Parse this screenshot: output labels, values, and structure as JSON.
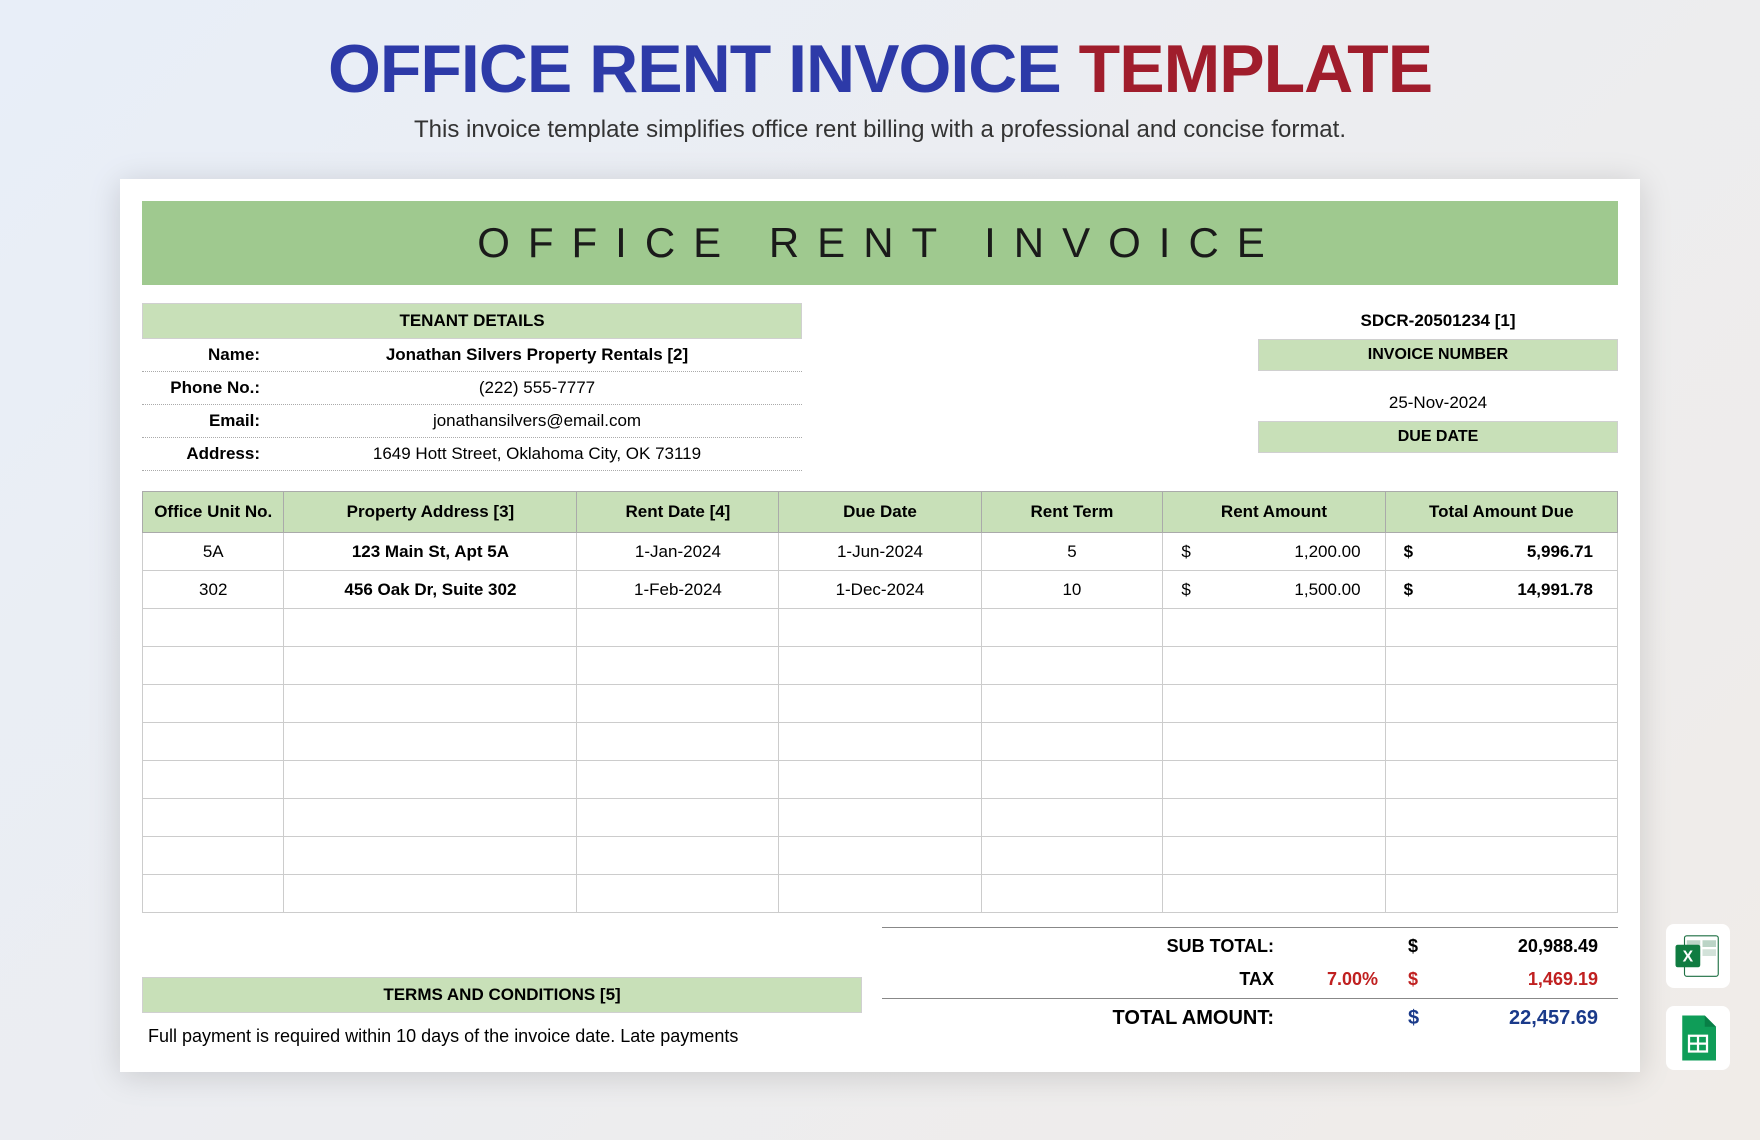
{
  "header": {
    "title_part1": "OFFICE RENT INVOICE",
    "title_part2": "TEMPLATE",
    "subtitle": "This invoice template simplifies office rent billing with a professional and concise format."
  },
  "invoice": {
    "banner": "OFFICE RENT INVOICE",
    "tenant_header": "TENANT DETAILS",
    "labels": {
      "name": "Name:",
      "phone": "Phone No.:",
      "email": "Email:",
      "address": "Address:"
    },
    "tenant": {
      "name": "Jonathan Silvers Property Rentals  [2]",
      "phone": "(222) 555-7777",
      "email": "jonathansilvers@email.com",
      "address": "1649 Hott Street, Oklahoma City, OK 73119"
    },
    "invoice_number": "SDCR-20501234 [1]",
    "invoice_number_label": "INVOICE NUMBER",
    "due_date": "25-Nov-2024",
    "due_date_label": "DUE DATE",
    "columns": {
      "unit": "Office Unit No.",
      "address": "Property Address [3]",
      "rent_date": "Rent Date [4]",
      "due_date": "Due Date",
      "rent_term": "Rent Term",
      "rent_amount": "Rent Amount",
      "total_due": "Total Amount Due"
    },
    "rows": [
      {
        "unit": "5A",
        "address": "123 Main St, Apt 5A",
        "rent_date": "1-Jan-2024",
        "due_date": "1-Jun-2024",
        "term": "5",
        "cur": "$",
        "amount": "1,200.00",
        "tcur": "$",
        "total": "5,996.71"
      },
      {
        "unit": "302",
        "address": "456 Oak Dr, Suite 302",
        "rent_date": "1-Feb-2024",
        "due_date": "1-Dec-2024",
        "term": "10",
        "cur": "$",
        "amount": "1,500.00",
        "tcur": "$",
        "total": "14,991.78"
      }
    ],
    "totals": {
      "subtotal_label": "SUB TOTAL:",
      "subtotal_cur": "$",
      "subtotal": "20,988.49",
      "tax_label": "TAX",
      "tax_pct": "7.00%",
      "tax_cur": "$",
      "tax": "1,469.19",
      "total_label": "TOTAL AMOUNT:",
      "total_cur": "$",
      "total": "22,457.69"
    },
    "terms_header": "TERMS AND CONDITIONS [5]",
    "terms_text": "Full payment is required within 10 days of the invoice date. Late payments"
  }
}
